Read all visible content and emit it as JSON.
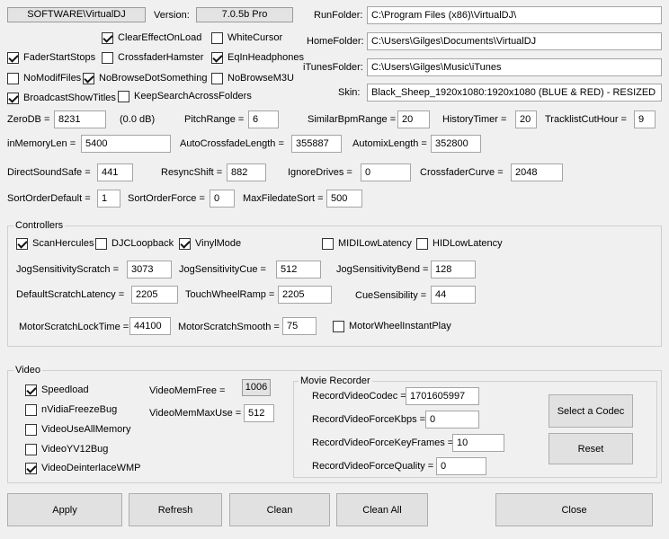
{
  "header": {
    "regkey": "SOFTWARE\\VirtualDJ",
    "version_label": "Version:",
    "version_value": "7.0.5b Pro"
  },
  "folders": {
    "run_label": "RunFolder:",
    "run_value": "C:\\Program Files (x86)\\VirtualDJ\\",
    "home_label": "HomeFolder:",
    "home_value": "C:\\Users\\Gilges\\Documents\\VirtualDJ",
    "itunes_label": "iTunesFolder:",
    "itunes_value": "C:\\Users\\Gilges\\Music\\iTunes",
    "skin_label": "Skin:",
    "skin_value": "Black_Sheep_1920x1080:1920x1080 (BLUE & RED) - RESIZED"
  },
  "options": {
    "clear_effect_on_load": "ClearEffectOnLoad",
    "white_cursor": "WhiteCursor",
    "fader_start_stops": "FaderStartStops",
    "crossfader_hamster": "CrossfaderHamster",
    "eq_in_headphones": "EqInHeadphones",
    "no_modif_files": "NoModifFiles",
    "no_browse_dot_something": "NoBrowseDotSomething",
    "no_browse_m3u": "NoBrowseM3U",
    "broadcast_show_titles": "BroadcastShowTitles",
    "keep_search_across_folders": "KeepSearchAcrossFolders"
  },
  "params": {
    "zerodb_label": "ZeroDB =",
    "zerodb_value": "8231",
    "zerodb_db": "(0.0 dB)",
    "pitch_range_label": "PitchRange =",
    "pitch_range_value": "6",
    "similar_bpm_label": "SimilarBpmRange =",
    "similar_bpm_value": "20",
    "history_timer_label": "HistoryTimer =",
    "history_timer_value": "20",
    "tracklist_cut_label": "TracklistCutHour =",
    "tracklist_cut_value": "9",
    "in_memory_len_label": "inMemoryLen =",
    "in_memory_len_value": "5400",
    "auto_crossfade_label": "AutoCrossfadeLength =",
    "auto_crossfade_value": "355887",
    "automix_length_label": "AutomixLength =",
    "automix_length_value": "352800",
    "direct_sound_label": "DirectSoundSafe =",
    "direct_sound_value": "441",
    "resync_shift_label": "ResyncShift =",
    "resync_shift_value": "882",
    "ignore_drives_label": "IgnoreDrives =",
    "ignore_drives_value": "0",
    "crossfader_curve_label": "CrossfaderCurve =",
    "crossfader_curve_value": "2048",
    "sort_default_label": "SortOrderDefault =",
    "sort_default_value": "1",
    "sort_force_label": "SortOrderForce =",
    "sort_force_value": "0",
    "max_filedate_label": "MaxFiledateSort =",
    "max_filedate_value": "500"
  },
  "controllers": {
    "title": "Controllers",
    "scan_hercules": "ScanHercules",
    "djc_loopback": "DJCLoopback",
    "vinyl_mode": "VinylMode",
    "midi_low_latency": "MIDILowLatency",
    "hid_low_latency": "HIDLowLatency",
    "jog_scratch_label": "JogSensitivityScratch =",
    "jog_scratch_value": "3073",
    "jog_cue_label": "JogSensitivityCue =",
    "jog_cue_value": "512",
    "jog_bend_label": "JogSensitivityBend =",
    "jog_bend_value": "128",
    "default_latency_label": "DefaultScratchLatency =",
    "default_latency_value": "2205",
    "touch_ramp_label": "TouchWheelRamp =",
    "touch_ramp_value": "2205",
    "cue_sens_label": "CueSensibility =",
    "cue_sens_value": "44",
    "motor_lock_label": "MotorScratchLockTime =",
    "motor_lock_value": "44100",
    "motor_smooth_label": "MotorScratchSmooth =",
    "motor_smooth_value": "75",
    "motor_wheel_instant": "MotorWheelInstantPlay"
  },
  "video": {
    "title": "Video",
    "speedload": "Speedload",
    "nvidia_freeze_bug": "nVidiaFreezeBug",
    "video_use_all_memory": "VideoUseAllMemory",
    "video_yv12_bug": "VideoYV12Bug",
    "video_deinterlace_wmp": "VideoDeinterlaceWMP",
    "mem_free_label": "VideoMemFree =",
    "mem_free_value": "1006",
    "mem_max_use_label": "VideoMemMaxUse =",
    "mem_max_use_value": "512"
  },
  "movie_recorder": {
    "title": "Movie Recorder",
    "codec_label": "RecordVideoCodec =",
    "codec_value": "1701605997",
    "kbps_label": "RecordVideoForceKbps =",
    "kbps_value": "0",
    "keyframes_label": "RecordVideoForceKeyFrames =",
    "keyframes_value": "10",
    "quality_label": "RecordVideoForceQuality =",
    "quality_value": "0",
    "select_codec_button": "Select a Codec",
    "reset_button": "Reset"
  },
  "footer": {
    "apply": "Apply",
    "refresh": "Refresh",
    "clean": "Clean",
    "clean_all": "Clean All",
    "close": "Close"
  }
}
